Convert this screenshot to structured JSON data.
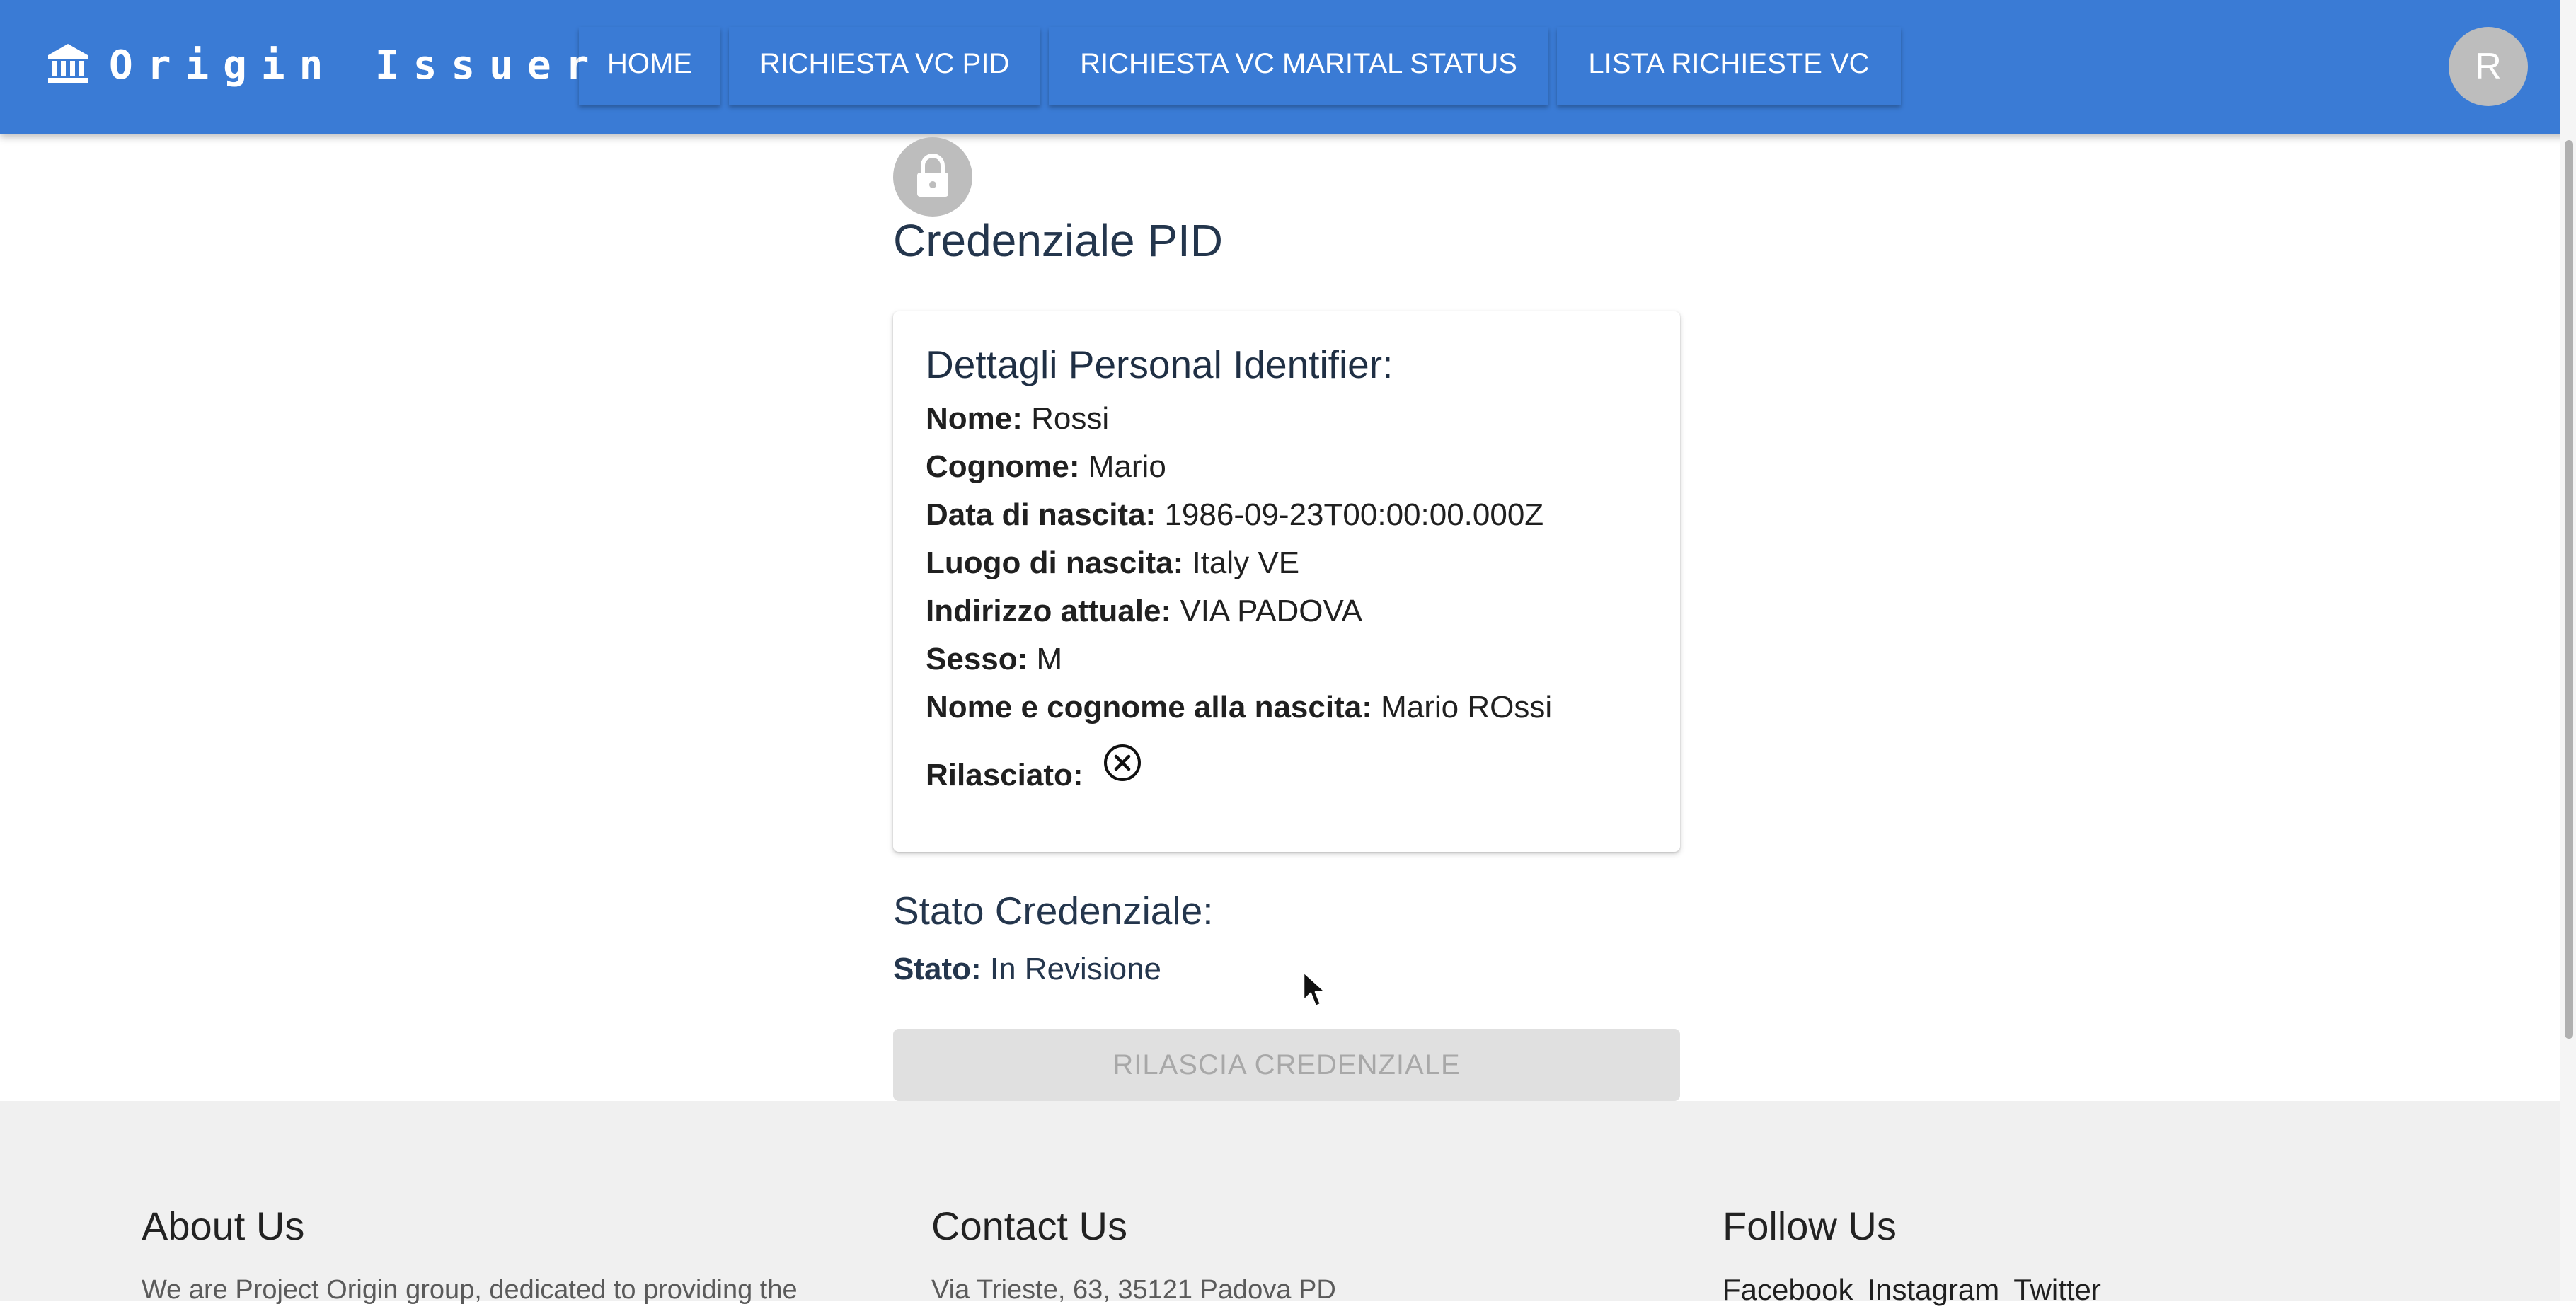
{
  "header": {
    "brand_title": "Origin Issuer",
    "brand_icon": "bank-icon",
    "nav": [
      {
        "label": "HOME"
      },
      {
        "label": "RICHIESTA VC PID"
      },
      {
        "label": "RICHIESTA VC MARITAL STATUS"
      },
      {
        "label": "LISTA RICHIESTE VC"
      }
    ],
    "avatar_initial": "R"
  },
  "main": {
    "lock_icon": "lock-icon",
    "title": "Credenziale PID",
    "card": {
      "title": "Dettagli Personal Identifier:",
      "fields": [
        {
          "label": "Nome:",
          "value": "Rossi"
        },
        {
          "label": "Cognome:",
          "value": "Mario"
        },
        {
          "label": "Data di nascita:",
          "value": "1986-09-23T00:00:00.000Z"
        },
        {
          "label": "Luogo di nascita:",
          "value": "Italy VE"
        },
        {
          "label": "Indirizzo attuale:",
          "value": "VIA PADOVA"
        },
        {
          "label": "Sesso:",
          "value": "M"
        },
        {
          "label": "Nome e cognome alla nascita:",
          "value": "Mario ROssi"
        }
      ],
      "issued_label": "Rilasciato:",
      "issued_icon": "cancel-circle-icon"
    },
    "status": {
      "heading": "Stato Credenziale:",
      "label": "Stato:",
      "value": "In Revisione"
    },
    "issue_button_label": "RILASCIA CREDENZIALE"
  },
  "footer": {
    "about": {
      "heading": "About Us",
      "text": "We are Project Origin group, dedicated to providing the"
    },
    "contact": {
      "heading": "Contact Us",
      "text": "Via Trieste, 63, 35121 Padova PD"
    },
    "follow": {
      "heading": "Follow Us",
      "links": [
        "Facebook",
        "Instagram",
        "Twitter"
      ]
    }
  },
  "colors": {
    "appbar": "#3a7bd5",
    "footer_bg": "#f0f0f0",
    "disabled_button": "#e0e0e0"
  }
}
